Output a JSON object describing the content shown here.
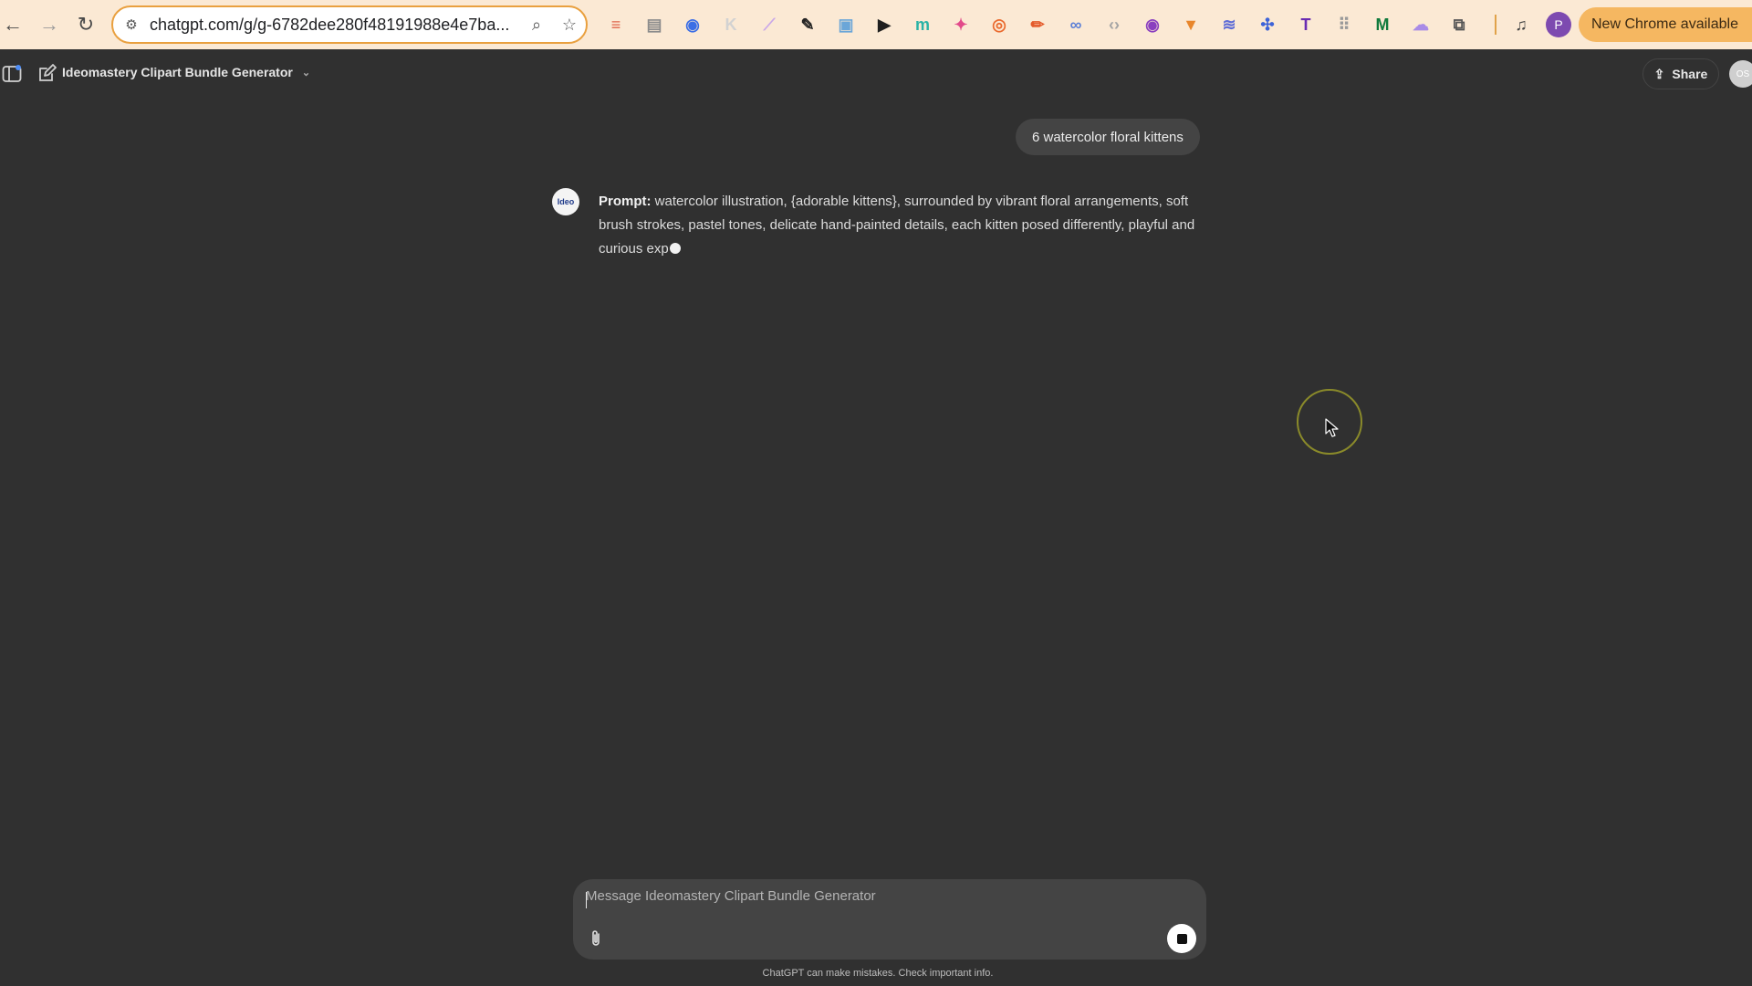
{
  "browser": {
    "url": "chatgpt.com/g/g-6782dee280f48191988e4e7ba...",
    "update_label": "New Chrome available",
    "profile_initial": "P"
  },
  "extensions": [
    {
      "name": "ext-red-book-icon",
      "color": "#e0644a",
      "glyph": "≡"
    },
    {
      "name": "ext-grey-tab-icon",
      "color": "#8c8c8c",
      "glyph": "▤"
    },
    {
      "name": "ext-blue-circle-icon",
      "color": "#3b6ee5",
      "glyph": "◉"
    },
    {
      "name": "ext-k-icon",
      "color": "#d2d2d2",
      "glyph": "K"
    },
    {
      "name": "ext-pen-icon",
      "color": "#c9a7e8",
      "glyph": "⟋"
    },
    {
      "name": "ext-eyedropper-icon",
      "color": "#222222",
      "glyph": "✎"
    },
    {
      "name": "ext-map-icon",
      "color": "#6ba6d8",
      "glyph": "▣"
    },
    {
      "name": "ext-play-icon",
      "color": "#1f1f1f",
      "glyph": "▶"
    },
    {
      "name": "ext-m-teal-icon",
      "color": "#2ab3a6",
      "glyph": "m"
    },
    {
      "name": "ext-colorful-icon",
      "color": "#e24a8a",
      "glyph": "✦"
    },
    {
      "name": "ext-ring-icon",
      "color": "#ea6b2f",
      "glyph": "◎"
    },
    {
      "name": "ext-brush-icon",
      "color": "#e45a2a",
      "glyph": "✏"
    },
    {
      "name": "ext-link-icon",
      "color": "#5b7fd6",
      "glyph": "∞"
    },
    {
      "name": "ext-code-icon",
      "color": "#a4a4a4",
      "glyph": "‹›"
    },
    {
      "name": "ext-eye-icon",
      "color": "#8a3fbf",
      "glyph": "◉"
    },
    {
      "name": "ext-fox-icon",
      "color": "#e8862b",
      "glyph": "▼"
    },
    {
      "name": "ext-layers-icon",
      "color": "#5d6bd6",
      "glyph": "≋"
    },
    {
      "name": "ext-puzzle-blue-icon",
      "color": "#3d63d8",
      "glyph": "✣"
    },
    {
      "name": "ext-t-icon",
      "color": "#6a2bb2",
      "glyph": "T"
    },
    {
      "name": "ext-grid-icon",
      "color": "#9a9a9a",
      "glyph": "⠿"
    },
    {
      "name": "ext-m-icon",
      "color": "#0f7a3c",
      "glyph": "M"
    },
    {
      "name": "ext-cloud-icon",
      "color": "#a98be6",
      "glyph": "☁"
    },
    {
      "name": "extensions-puzzle-icon",
      "color": "#555555",
      "glyph": "⧉"
    }
  ],
  "header": {
    "gpt_name": "Ideomastery Clipart Bundle Generator",
    "share_label": "Share",
    "avatar_text": "OS"
  },
  "conversation": {
    "user_message": "6 watercolor floral kittens",
    "assistant_avatar_text": "Ideo",
    "assistant_lead": "Prompt:",
    "assistant_text": " watercolor illustration, {adorable kittens}, surrounded by vibrant floral arrangements, soft brush strokes, pastel tones, delicate hand-painted details, each kitten posed differently, playful and curious exp"
  },
  "composer": {
    "placeholder": "Message Ideomastery Clipart Bundle Generator"
  },
  "footer": {
    "disclaimer": "ChatGPT can make mistakes. Check important info."
  }
}
